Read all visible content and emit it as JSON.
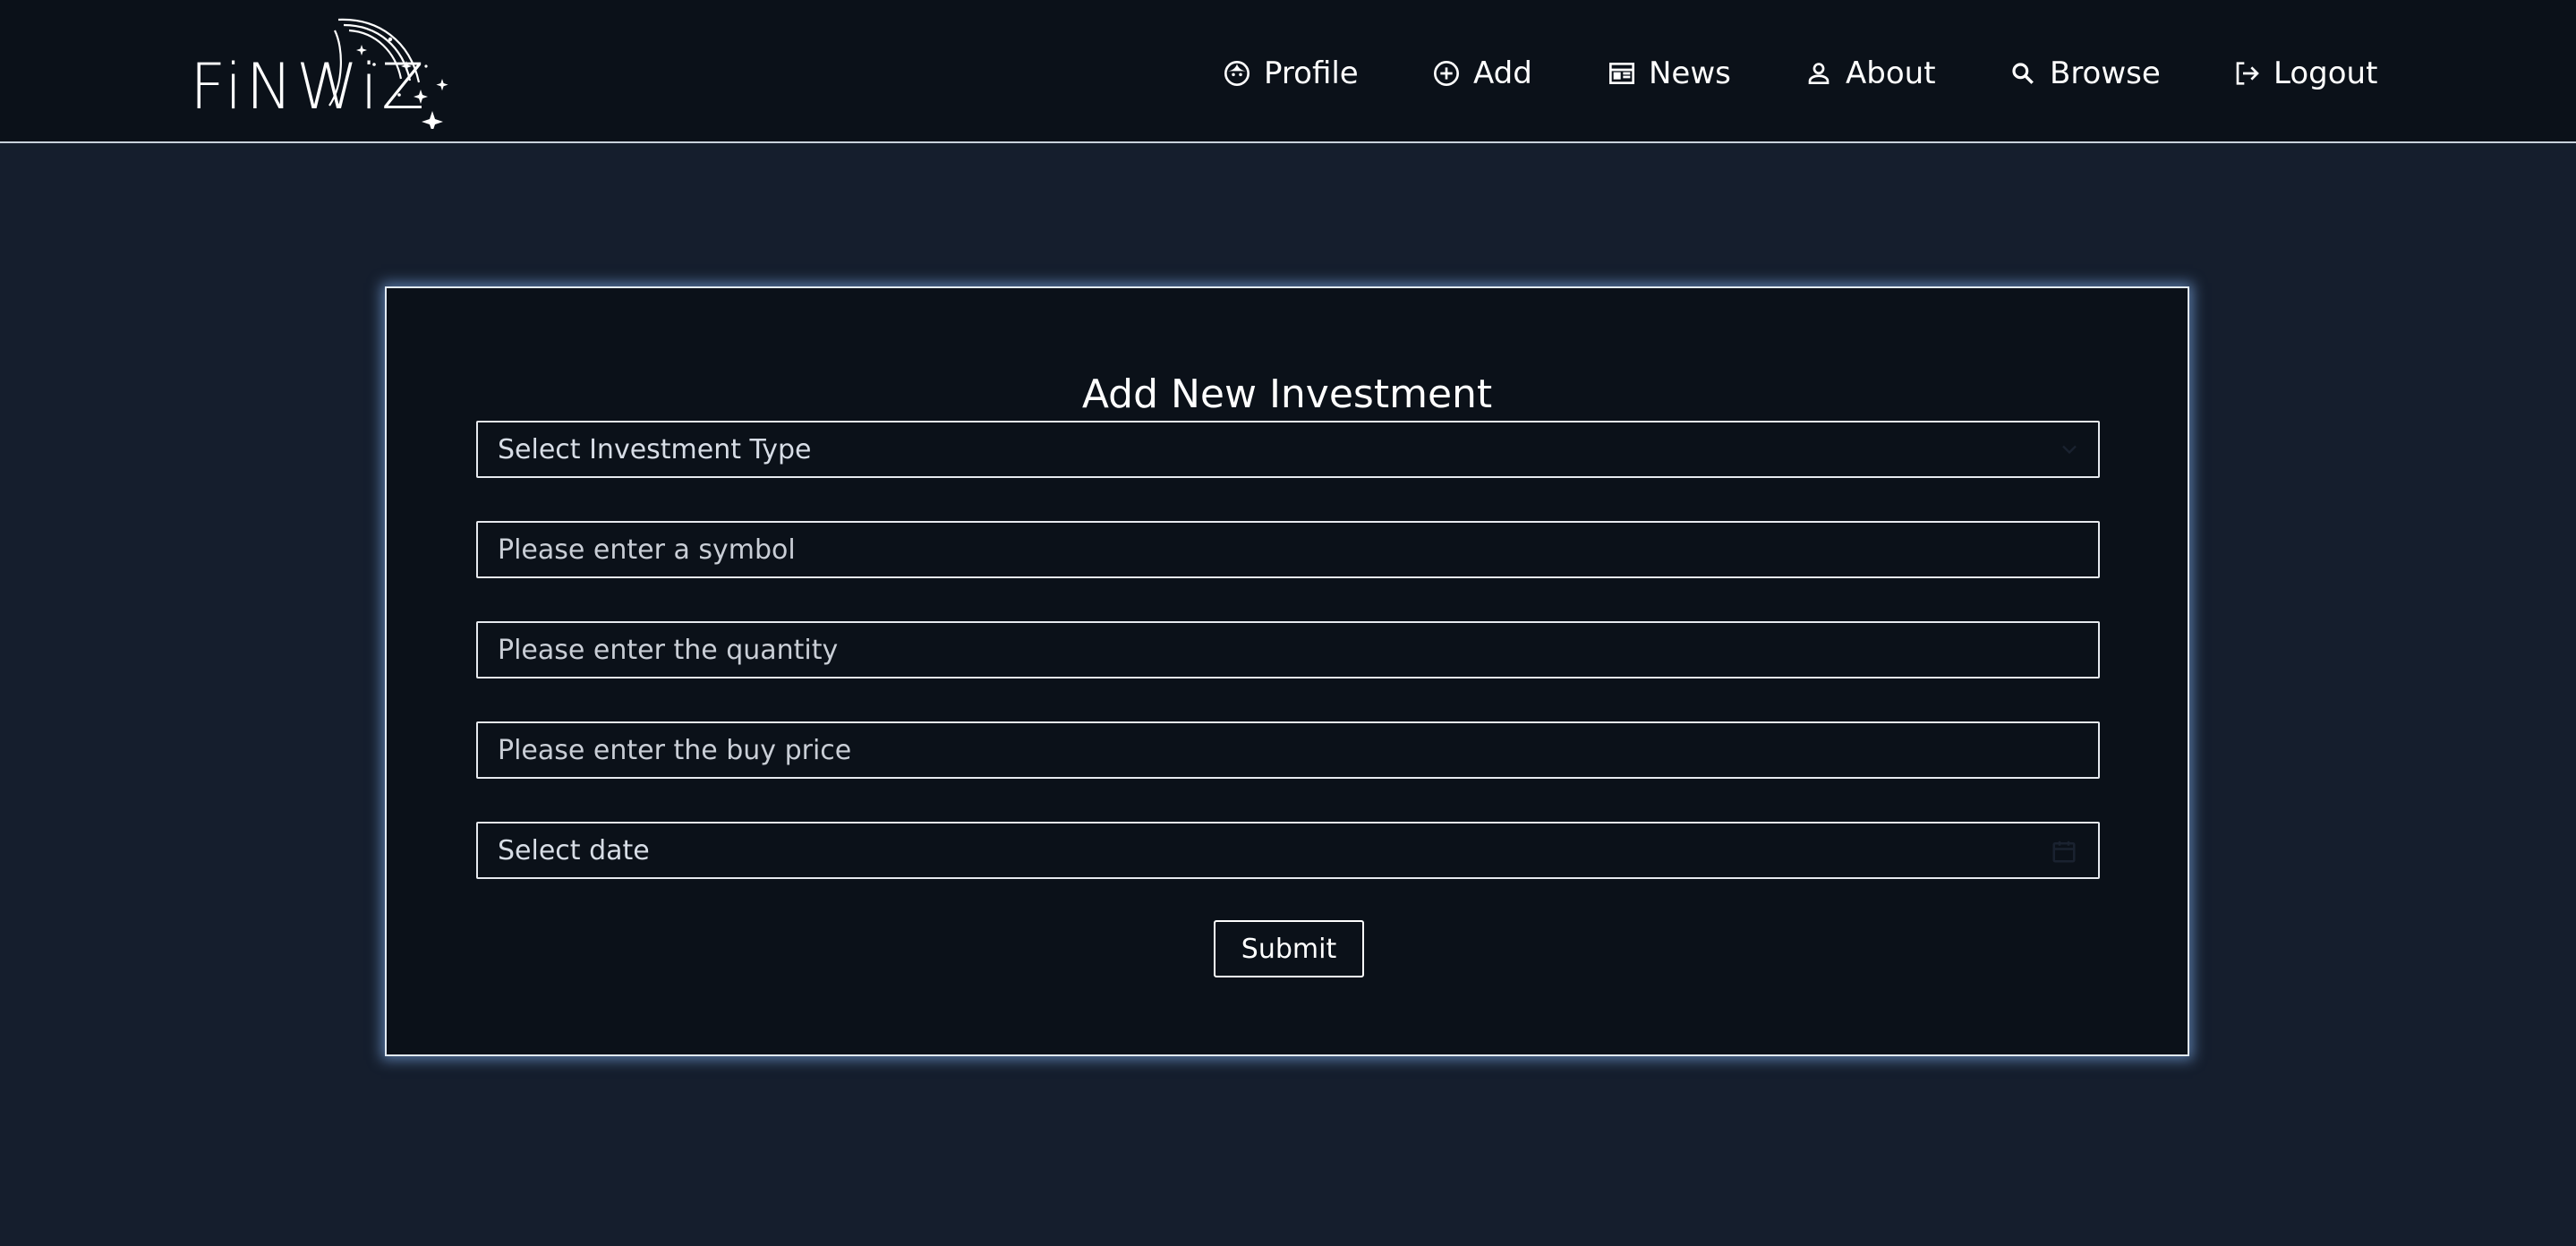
{
  "brand": {
    "name": "FiNWiZ"
  },
  "nav": {
    "items": [
      {
        "label": "Profile",
        "icon": "face-icon"
      },
      {
        "label": "Add",
        "icon": "add-circle-icon"
      },
      {
        "label": "News",
        "icon": "newspaper-icon"
      },
      {
        "label": "About",
        "icon": "person-icon"
      },
      {
        "label": "Browse",
        "icon": "search-icon"
      },
      {
        "label": "Logout",
        "icon": "logout-icon"
      }
    ]
  },
  "form": {
    "title": "Add New Investment",
    "investment_type": {
      "selected": "Select Investment Type"
    },
    "symbol": {
      "placeholder": "Please enter a symbol"
    },
    "quantity": {
      "placeholder": "Please enter the quantity"
    },
    "buy_price": {
      "placeholder": "Please enter the buy price"
    },
    "date": {
      "placeholder": "Select date"
    },
    "submit_label": "Submit"
  },
  "colors": {
    "page_background": "#151e2d",
    "surface": "#0b1119",
    "border": "#e6e9ee",
    "glow": "#8cbeff",
    "text": "#ffffff"
  }
}
